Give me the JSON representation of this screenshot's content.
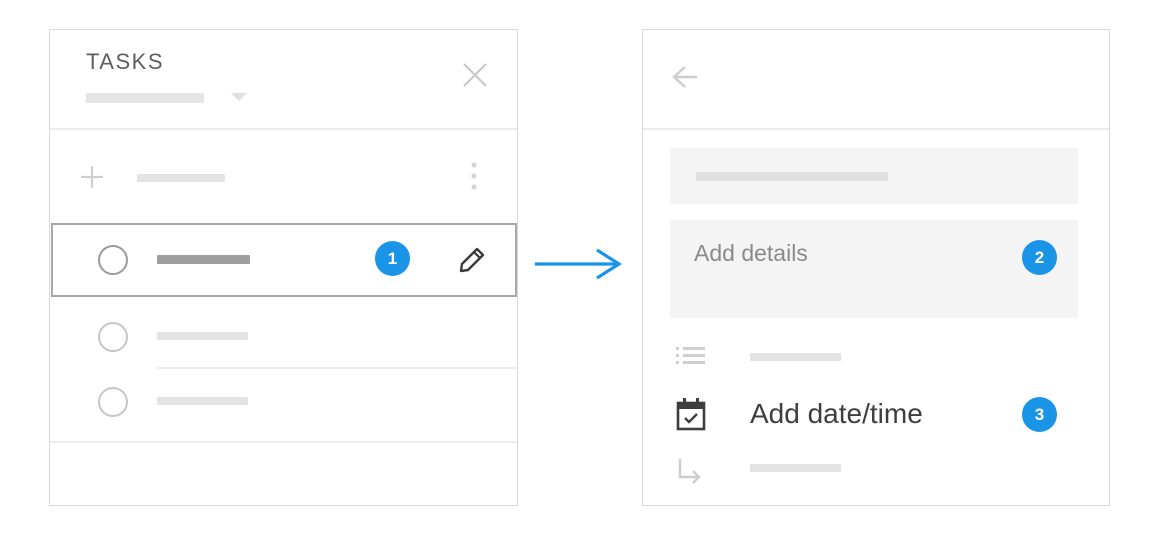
{
  "tasks_panel": {
    "title": "TASKS",
    "icons": {
      "close": "close-icon",
      "dropdown": "chevron-down-icon",
      "add": "plus-icon",
      "more": "more-vert-icon",
      "edit": "pencil-icon"
    },
    "selected_task_badge": "1"
  },
  "detail_panel": {
    "details_placeholder": "Add details",
    "details_badge": "2",
    "date_label": "Add date/time",
    "date_badge": "3",
    "icons": {
      "back": "arrow-back-icon",
      "list": "list-icon",
      "calendar": "calendar-check-icon",
      "subtask": "subdirectory-arrow-icon"
    }
  },
  "colors": {
    "accent": "#1a94e6",
    "border": "#dadada",
    "placeholder_bar": "#e3e3e3",
    "selected_bar": "#9e9e9e"
  }
}
